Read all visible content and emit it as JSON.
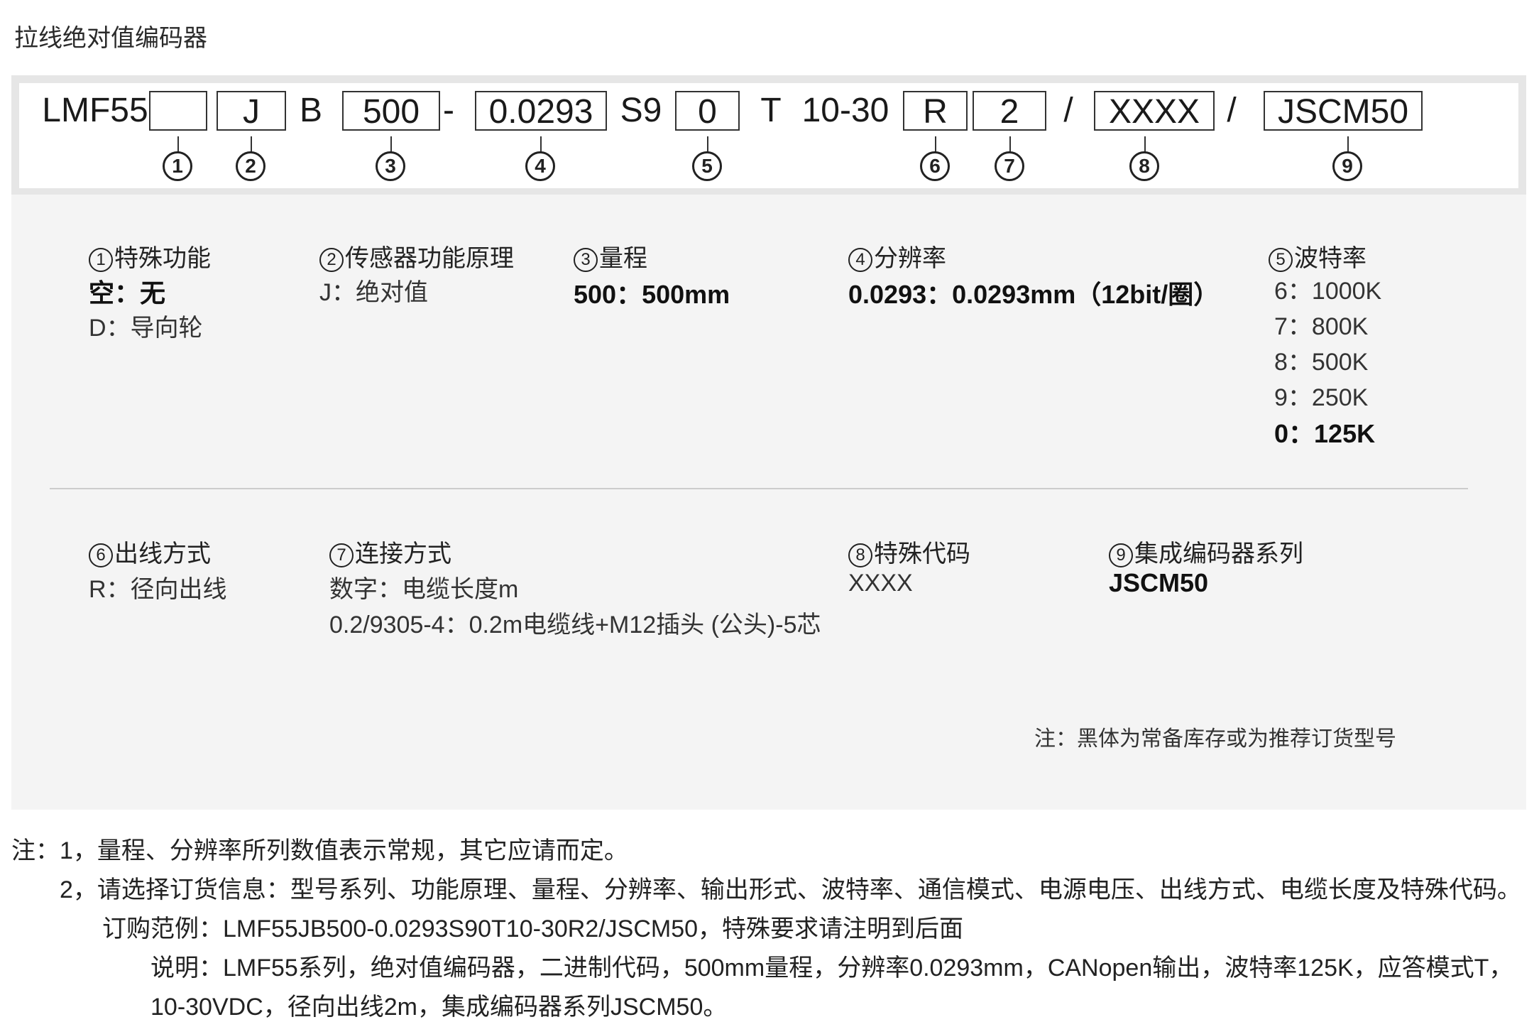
{
  "title": "拉线绝对值编码器",
  "model_code": {
    "prefix": "LMF55",
    "box1": "",
    "box2": "J",
    "letter_b": "B",
    "box3": "500",
    "dash": "-",
    "box4": "0.0293",
    "s9": "S9",
    "box5": "0",
    "t": "T",
    "voltage": "10-30",
    "box6": "R",
    "box7": "2",
    "slash1": "/",
    "box8": "XXXX",
    "slash2": "/",
    "box9": "JSCM50",
    "markers": [
      "1",
      "2",
      "3",
      "4",
      "5",
      "6",
      "7",
      "8",
      "9"
    ]
  },
  "sections": {
    "s1": {
      "num": "1",
      "heading": "特殊功能",
      "items": [
        "空：无",
        "D：导向轮"
      ]
    },
    "s2": {
      "num": "2",
      "heading": "传感器功能原理",
      "items": [
        "J：绝对值"
      ]
    },
    "s3": {
      "num": "3",
      "heading": "量程",
      "items": [
        "500：500mm"
      ]
    },
    "s4": {
      "num": "4",
      "heading": "分辨率",
      "items": [
        "0.0293：0.0293mm（12bit/圈）"
      ]
    },
    "s5": {
      "num": "5",
      "heading": "波特率",
      "items": [
        "6：1000K",
        "7：800K",
        "8：500K",
        "9：250K",
        "0：125K"
      ]
    },
    "s6": {
      "num": "6",
      "heading": "出线方式",
      "items": [
        "R：径向出线"
      ]
    },
    "s7": {
      "num": "7",
      "heading": "连接方式",
      "items": [
        "数字：电缆长度m",
        "0.2/9305-4：0.2m电缆线+M12插头 (公头)-5芯"
      ]
    },
    "s8": {
      "num": "8",
      "heading": "特殊代码",
      "items": [
        "XXXX"
      ]
    },
    "s9": {
      "num": "9",
      "heading": "集成编码器系列",
      "items": [
        "JSCM50"
      ]
    }
  },
  "panel_note": "注：黑体为常备库存或为推荐订货型号",
  "notes": {
    "line1": "注：1，量程、分辨率所列数值表示常规，其它应请而定。",
    "line2": "2，请选择订货信息：型号系列、功能原理、量程、分辨率、输出形式、波特率、通信模式、电源电压、出线方式、电缆长度及特殊代码。",
    "line3": "订购范例：LMF55JB500-0.0293S90T10-30R2/JSCM50，特殊要求请注明到后面",
    "line4": "说明：LMF55系列，绝对值编码器，二进制代码，500mm量程，分辨率0.0293mm，CANopen输出，波特率125K，应答模式T，",
    "line5": "10-30VDC，径向出线2m，集成编码器系列JSCM50。"
  }
}
